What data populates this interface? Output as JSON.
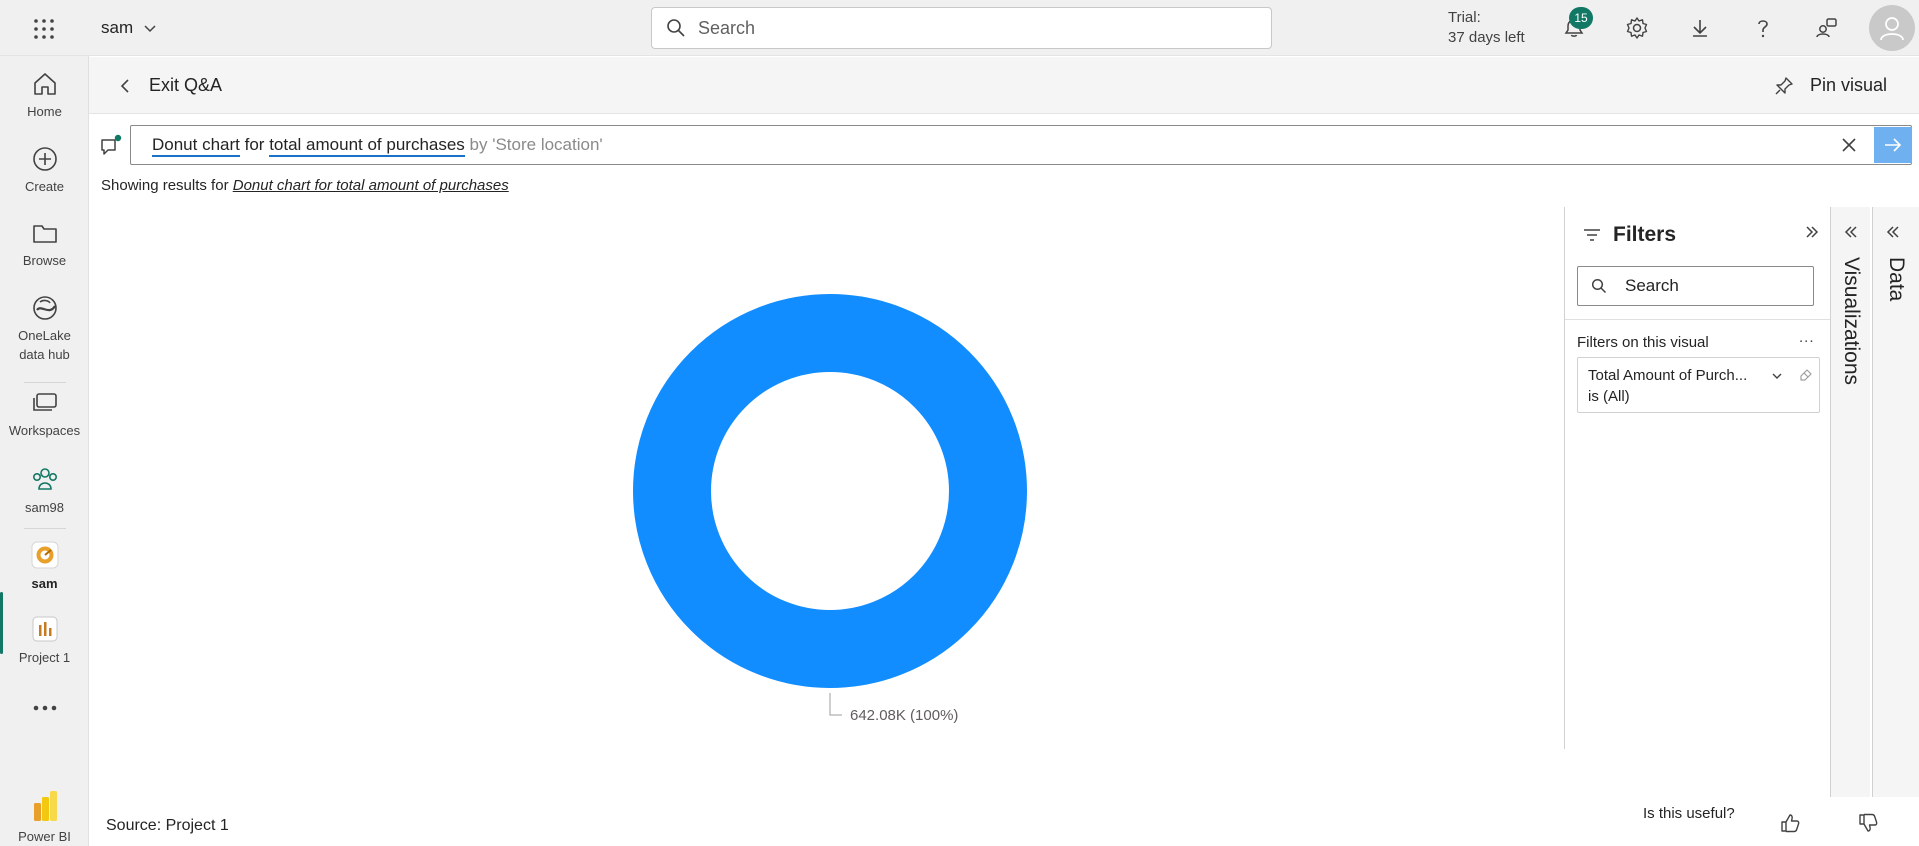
{
  "topbar": {
    "workspace_name": "sam",
    "search_placeholder": "Search",
    "trial_line1": "Trial:",
    "trial_line2": "37 days left",
    "notification_count": "15",
    "icons": [
      "app-launcher-icon",
      "bell-icon",
      "gear-icon",
      "download-icon",
      "help-icon",
      "share-feedback-icon",
      "user-avatar-icon"
    ]
  },
  "nav": {
    "items": [
      {
        "label": "Home",
        "icon": "home-icon"
      },
      {
        "label": "Create",
        "icon": "plus-circle-icon"
      },
      {
        "label": "Browse",
        "icon": "folder-icon"
      },
      {
        "label": "OneLake data hub",
        "icon": "onelake-icon"
      },
      {
        "label": "Workspaces",
        "icon": "workspaces-icon"
      },
      {
        "label": "sam98",
        "icon": "people-icon"
      },
      {
        "label": "sam",
        "icon": "workspace-logo-icon",
        "active": true
      },
      {
        "label": "Project 1",
        "icon": "report-icon"
      },
      {
        "label": "Power BI",
        "icon": "powerbi-logo-icon"
      }
    ]
  },
  "subheader": {
    "exit_label": "Exit Q&A",
    "pin_label": "Pin visual"
  },
  "qna": {
    "term1": "Donut chart",
    "word_for": " for ",
    "term2": "total amount of purchases",
    "suggestion": " by 'Store location'",
    "showing_prefix": "Showing results for",
    "showing_link": "Donut chart for total amount of purchases"
  },
  "chart_data": {
    "type": "pie",
    "variant": "donut",
    "slices": [
      {
        "label": "642.08K (100%)",
        "value": 642080,
        "percent": 100
      }
    ],
    "color": "#118dff"
  },
  "filters": {
    "title": "Filters",
    "search_placeholder": "Search",
    "section_label": "Filters on this visual",
    "more": "...",
    "card_name": "Total Amount of Purch...",
    "card_state": "is (All)"
  },
  "sidetabs": {
    "visualizations": "Visualizations",
    "data": "Data"
  },
  "footer": {
    "source": "Source: Project 1",
    "useful": "Is this useful?"
  },
  "colors": {
    "accent": "#117865",
    "donut": "#118dff",
    "go_button": "#6fb1f0"
  }
}
